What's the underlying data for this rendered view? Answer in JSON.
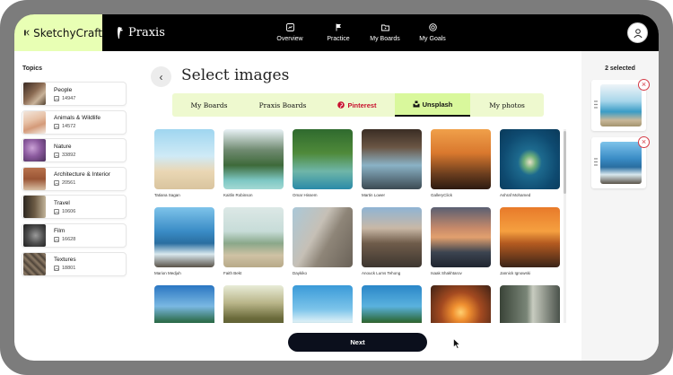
{
  "brand": {
    "sketchy_name": "SketchyCraft",
    "praxis_name": "Praxis"
  },
  "nav": {
    "overview": "Overview",
    "practice": "Practice",
    "boards": "My Boards",
    "goals": "My Goals"
  },
  "sidebar": {
    "title": "Topics",
    "items": [
      {
        "name": "People",
        "count": "14947"
      },
      {
        "name": "Animals & Wildlife",
        "count": "14572"
      },
      {
        "name": "Nature",
        "count": "33892"
      },
      {
        "name": "Architecture & Interior",
        "count": "20561"
      },
      {
        "name": "Travel",
        "count": "10606"
      },
      {
        "name": "Film",
        "count": "16628"
      },
      {
        "name": "Textures",
        "count": "18801"
      }
    ]
  },
  "main": {
    "title": "Select images",
    "tabs": {
      "my_boards": "My Boards",
      "praxis_boards": "Praxis Boards",
      "pinterest": "Pinterest",
      "unsplash": "Unsplash",
      "my_photos": "My photos"
    },
    "photos": [
      {
        "credit": "Tatiana Sagan"
      },
      {
        "credit": "Kaitlin Robinson"
      },
      {
        "credit": "Omar Hissem"
      },
      {
        "credit": "Martin Lower"
      },
      {
        "credit": "GalleryClick"
      },
      {
        "credit": "Ashraf Mohamed"
      },
      {
        "credit": "Marion Medjuh"
      },
      {
        "credit": "Faith Bekt"
      },
      {
        "credit": "Daykiko"
      },
      {
        "credit": "Anouck Lums Tehong"
      },
      {
        "credit": "Isaak Shakhtarov"
      },
      {
        "credit": "Jannick Ignowski"
      },
      {
        "credit": ""
      },
      {
        "credit": ""
      },
      {
        "credit": ""
      },
      {
        "credit": ""
      },
      {
        "credit": ""
      },
      {
        "credit": ""
      }
    ],
    "next_label": "Next"
  },
  "selected": {
    "count_label": "2 selected"
  },
  "colors": {
    "accent_green": "#e8ffb4",
    "tab_bar": "#eef9cf",
    "active_tab": "#d9f89c",
    "pinterest_red": "#c8102e",
    "remove_red": "#d43b46"
  }
}
